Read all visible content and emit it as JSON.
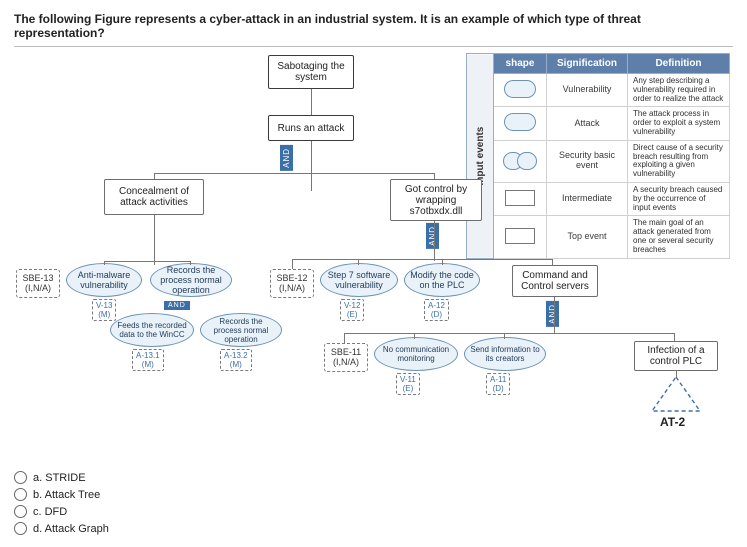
{
  "question": "The following Figure represents a cyber-attack in an industrial system. It is an example of which type of threat representation?",
  "diagram": {
    "top1": "Sabotaging the system",
    "top2": "Runs an attack",
    "conceal": "Concealment of attack activities",
    "gotcontrol": "Got control by wrapping s7otbxdx.dll",
    "cmdctrl": "Command and Control servers",
    "infection": "Infection of a control PLC",
    "at2": "AT-2",
    "sbe13": {
      "id": "SBE-13",
      "na": "(I,N/A)"
    },
    "sbe12": {
      "id": "SBE-12",
      "na": "(I,N/A)"
    },
    "sbe11": {
      "id": "SBE-11",
      "na": "(I,N/A)"
    },
    "ell": {
      "antimalware": "Anti-malware vulnerability",
      "recordsnormal": "Records the process normal operation",
      "step7": "Step 7 software vulnerability",
      "modifyplc": "Modify the code on the PLC",
      "feeds": "Feeds the recorded data to the WinCC",
      "recordsnormal2": "Records the process normal operation",
      "nocomm": "No communication monitoring",
      "sendinfo": "Send information to its creators"
    },
    "tags": {
      "v13": "V-13",
      "m1": "(M)",
      "a131": "A-13.1",
      "m2": "(M)",
      "a132": "A-13.2",
      "m3": "(M)",
      "v12": "V-12",
      "e1": "(E)",
      "a12": "A-12",
      "d1": "(D)",
      "v11": "V-11",
      "e2": "(E)",
      "a11": "A-11",
      "d2": "(D)"
    },
    "and": "AND"
  },
  "legend": {
    "headers": {
      "shape": "shape",
      "sig": "Signification",
      "def": "Definition",
      "events": "Input events"
    },
    "rows": [
      {
        "sig": "Vulnerability",
        "def": "Any step describing a vulnerability required in order to realize the attack"
      },
      {
        "sig": "Attack",
        "def": "The attack process in order to exploit a system vulnerability"
      },
      {
        "sig": "Security basic event",
        "def": "Direct cause of a security breach resulting from exploiting a given vulnerability"
      },
      {
        "sig": "Intermediate",
        "def": "A security breach caused by the occurrence of input events"
      },
      {
        "sig": "Top event",
        "def": "The main goal of an attack generated from one or several security breaches"
      }
    ]
  },
  "answers": {
    "a": "a. STRIDE",
    "b": "b. Attack Tree",
    "c": "c. DFD",
    "d": "d. Attack Graph"
  }
}
